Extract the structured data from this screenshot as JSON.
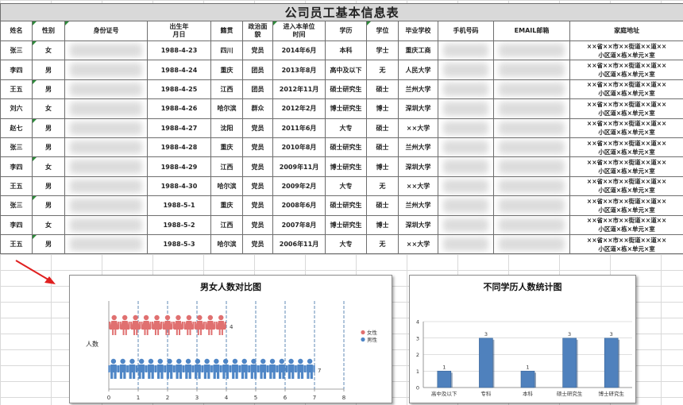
{
  "table": {
    "title": "公司员工基本信息表",
    "headers": [
      "姓名",
      "性别",
      "身份证号",
      "出生年\n月日",
      "籍贯",
      "政治面\n貌",
      "进入本单位\n时间",
      "学历",
      "学位",
      "毕业学校",
      "手机号码",
      "EMAIL邮箱",
      "家庭地址"
    ],
    "address_line1": "××省××市××街道××道××",
    "address_line2": "小区道×栋×单元×室",
    "rows": [
      [
        "张三",
        "女",
        "",
        "1988-4-23",
        "四川",
        "党员",
        "2014年6月",
        "本科",
        "学士",
        "重庆工商",
        "",
        ""
      ],
      [
        "李四",
        "男",
        "",
        "1988-4-24",
        "重庆",
        "团员",
        "2013年8月",
        "高中及以下",
        "无",
        "人民大学",
        "",
        ""
      ],
      [
        "王五",
        "男",
        "",
        "1988-4-25",
        "江西",
        "团员",
        "2012年11月",
        "硕士研究生",
        "硕士",
        "兰州大学",
        "",
        ""
      ],
      [
        "刘六",
        "女",
        "",
        "1988-4-26",
        "哈尔滨",
        "群众",
        "2012年2月",
        "博士研究生",
        "博士",
        "深圳大学",
        "",
        ""
      ],
      [
        "赵七",
        "男",
        "",
        "1988-4-27",
        "沈阳",
        "党员",
        "2011年6月",
        "大专",
        "硕士",
        "××大学",
        "",
        ""
      ],
      [
        "张三",
        "男",
        "",
        "1988-4-28",
        "重庆",
        "党员",
        "2010年8月",
        "硕士研究生",
        "硕士",
        "兰州大学",
        "",
        ""
      ],
      [
        "李四",
        "女",
        "",
        "1988-4-29",
        "江西",
        "党员",
        "2009年11月",
        "博士研究生",
        "博士",
        "深圳大学",
        "",
        ""
      ],
      [
        "王五",
        "男",
        "",
        "1988-4-30",
        "哈尔滨",
        "党员",
        "2009年2月",
        "大专",
        "无",
        "××大学",
        "",
        ""
      ],
      [
        "张三",
        "男",
        "",
        "1988-5-1",
        "重庆",
        "党员",
        "2008年6月",
        "硕士研究生",
        "硕士",
        "兰州大学",
        "",
        ""
      ],
      [
        "李四",
        "女",
        "",
        "1988-5-2",
        "江西",
        "党员",
        "2007年8月",
        "博士研究生",
        "博士",
        "深圳大学",
        "",
        ""
      ],
      [
        "王五",
        "男",
        "",
        "1988-5-3",
        "哈尔滨",
        "党员",
        "2006年11月",
        "大专",
        "无",
        "××大学",
        "",
        ""
      ]
    ]
  },
  "chart_data": [
    {
      "type": "bar",
      "title": "男女人数对比图",
      "ylabel": "人数",
      "xlabel": "",
      "xlim": [
        0,
        8
      ],
      "x_ticks": [
        "0",
        "1",
        "2",
        "3",
        "4",
        "5",
        "6",
        "7",
        "8"
      ],
      "series": [
        {
          "name": "女性",
          "value": 4,
          "color": "#e07070"
        },
        {
          "name": "男性",
          "value": 7,
          "color": "#4f86c6"
        }
      ],
      "legend": "right",
      "grid": "vertical dashed"
    },
    {
      "type": "bar",
      "title": "不同学历人数统计图",
      "categories": [
        "高中及以下",
        "专科",
        "本科",
        "硕士研究生",
        "博士研究生"
      ],
      "values": [
        1,
        3,
        1,
        3,
        3
      ],
      "ylim": [
        0,
        4
      ],
      "y_ticks": [
        "0",
        "1",
        "2",
        "3",
        "4"
      ],
      "color": "#4f81bd",
      "grid": "horizontal"
    }
  ]
}
